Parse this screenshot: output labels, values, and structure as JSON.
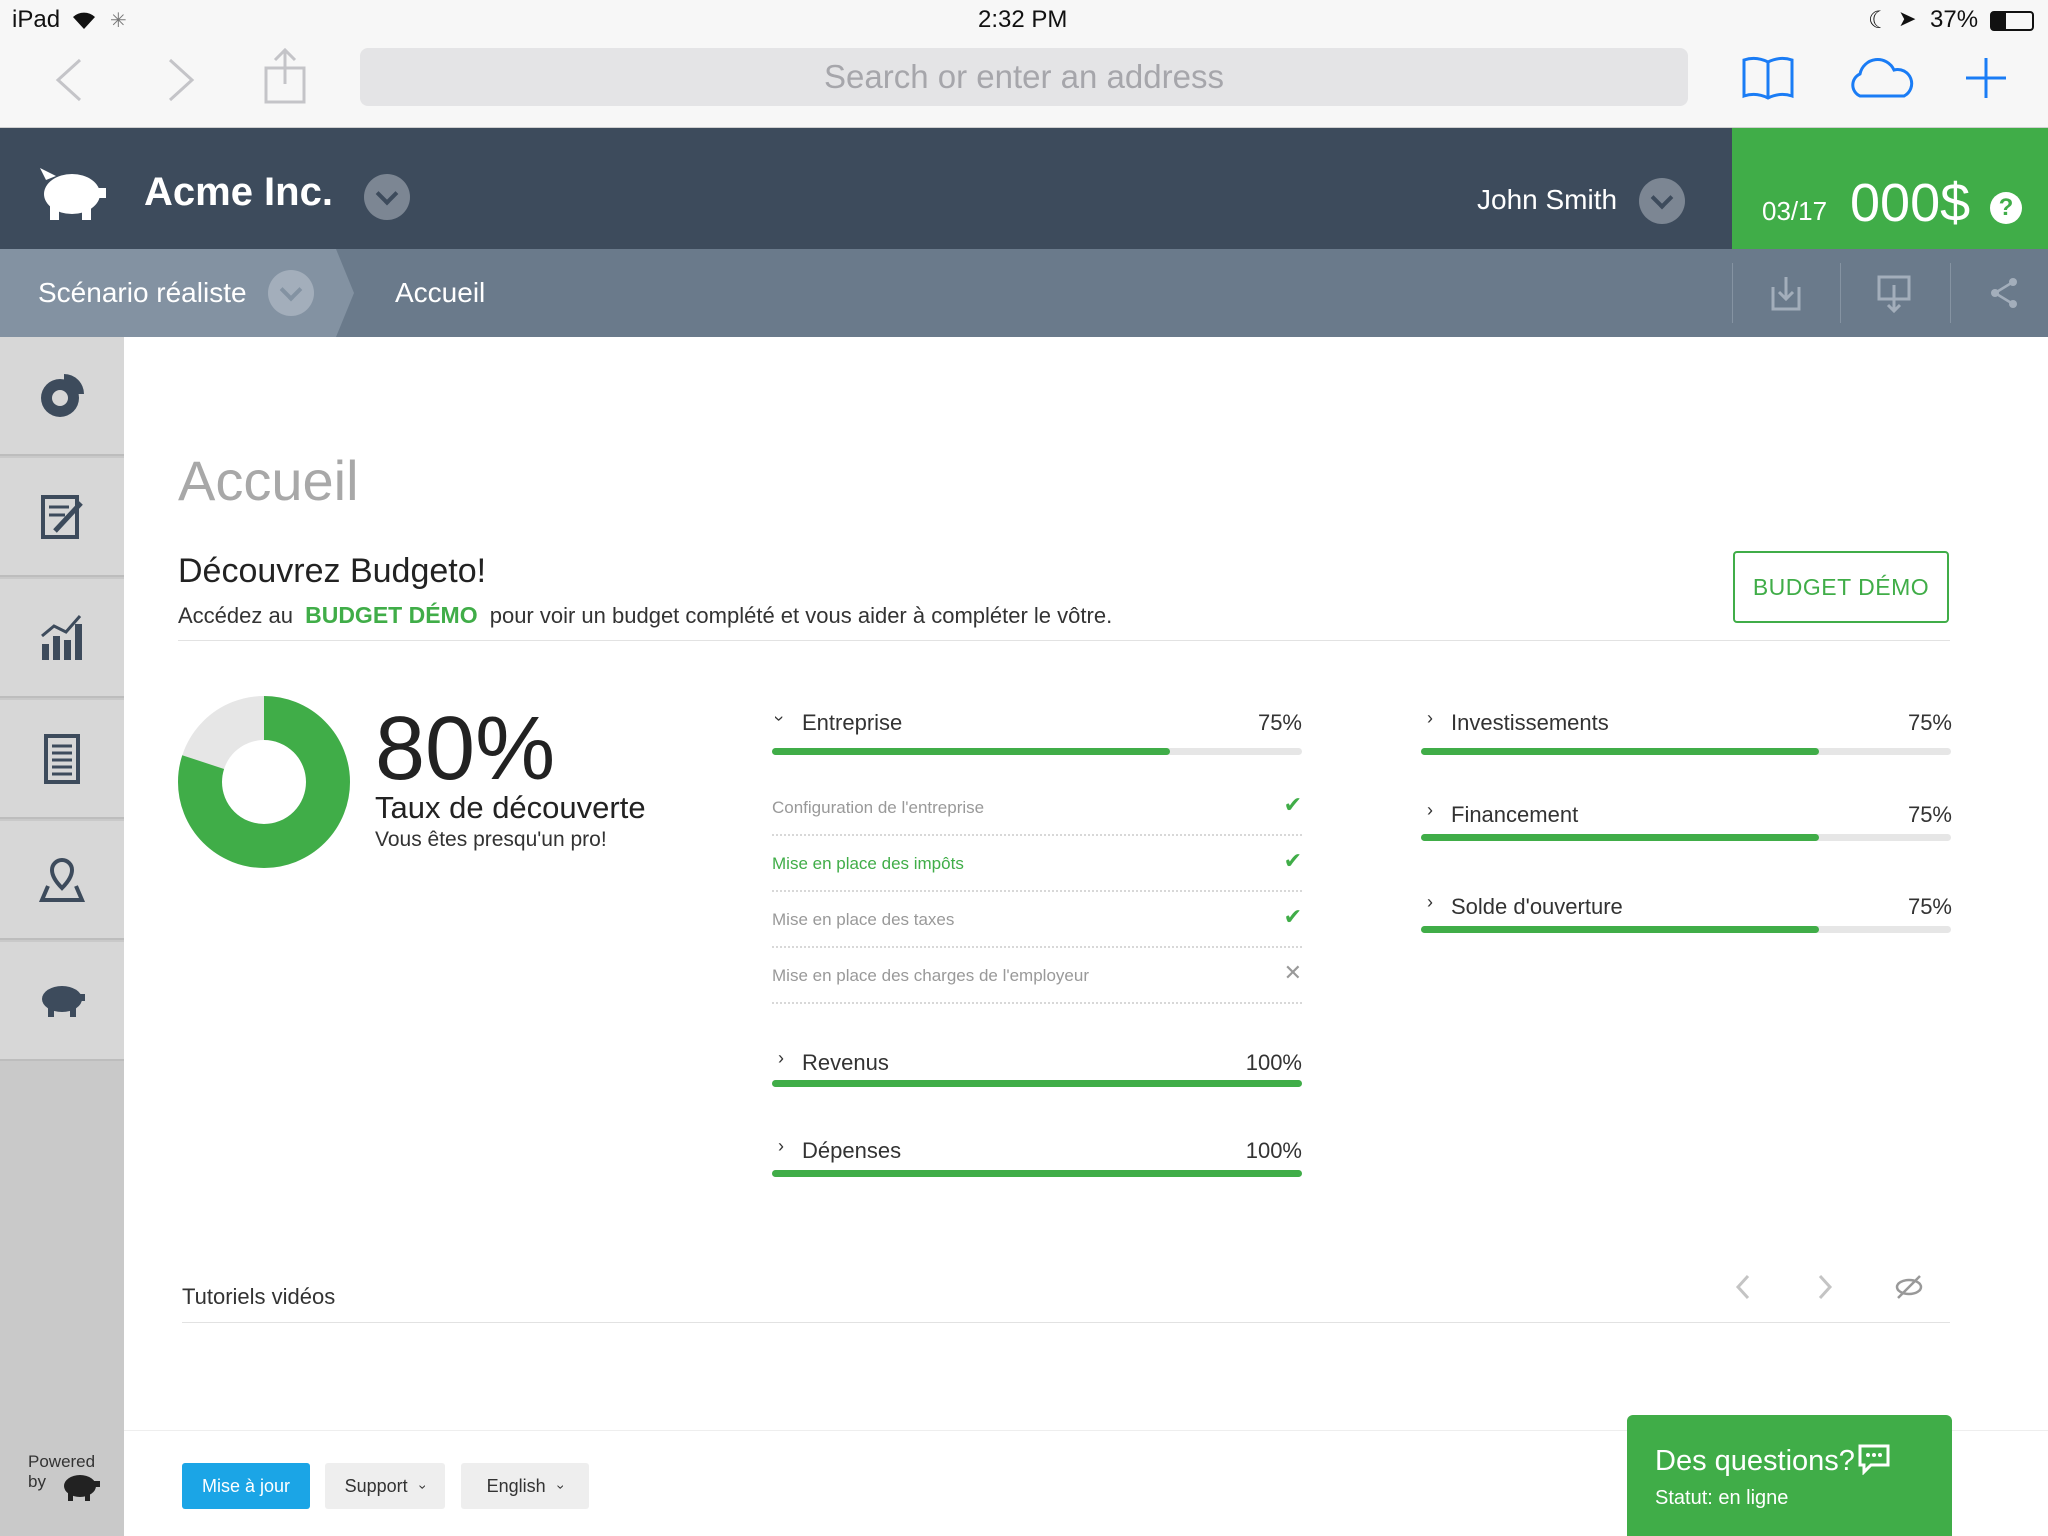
{
  "status_bar": {
    "device": "iPad",
    "time": "2:32 PM",
    "battery": "37%"
  },
  "browser": {
    "address_placeholder": "Search or enter an address"
  },
  "header": {
    "company": "Acme Inc.",
    "user": "John Smith",
    "date": "03/17",
    "amount": "000$",
    "help": "?"
  },
  "subheader": {
    "scenario": "Scénario réaliste",
    "breadcrumb": "Accueil"
  },
  "sidebar": {
    "items": [
      "pie-chart-icon",
      "document-edit-icon",
      "bar-chart-icon",
      "report-icon",
      "map-pin-icon",
      "piggy-bank-icon"
    ],
    "powered_by": "Powered by"
  },
  "main": {
    "title": "Accueil",
    "discover": {
      "title": "Découvrez Budgeto!",
      "text_before": "Accédez au",
      "highlight": "BUDGET DÉMO",
      "text_after": "pour voir un budget complété et vous aider à compléter le vôtre.",
      "button": "BUDGET DÉMO"
    },
    "discovery": {
      "percent_label": "80%",
      "percent_value": 80,
      "label": "Taux de découverte",
      "sub": "Vous êtes presqu'un pro!"
    },
    "sections_left": [
      {
        "label": "Entreprise",
        "pct": "75%",
        "value": 75,
        "expanded": true
      },
      {
        "label": "Revenus",
        "pct": "100%",
        "value": 100,
        "expanded": false
      },
      {
        "label": "Dépenses",
        "pct": "100%",
        "value": 100,
        "expanded": false
      }
    ],
    "entreprise_items": [
      {
        "label": "Configuration de l'entreprise",
        "done": true,
        "active": false,
        "mark": "✔"
      },
      {
        "label": "Mise en place des impôts",
        "done": true,
        "active": true,
        "mark": "✔"
      },
      {
        "label": "Mise en place des taxes",
        "done": true,
        "active": false,
        "mark": "✔"
      },
      {
        "label": "Mise en place des charges de l'employeur",
        "done": false,
        "active": false,
        "mark": "✕"
      }
    ],
    "sections_right": [
      {
        "label": "Investissements",
        "pct": "75%",
        "value": 75
      },
      {
        "label": "Financement",
        "pct": "75%",
        "value": 75
      },
      {
        "label": "Solde d'ouverture",
        "pct": "75%",
        "value": 75
      }
    ],
    "tutorials_title": "Tutoriels vidéos"
  },
  "footer": {
    "update": "Mise à jour",
    "support": "Support",
    "language": "English",
    "chat_title": "Des questions?",
    "chat_status": "Statut: en ligne"
  },
  "colors": {
    "accent": "#40ad48",
    "header": "#3d4b5c",
    "subheader": "#6a7a8b",
    "update": "#1ba5e6"
  }
}
